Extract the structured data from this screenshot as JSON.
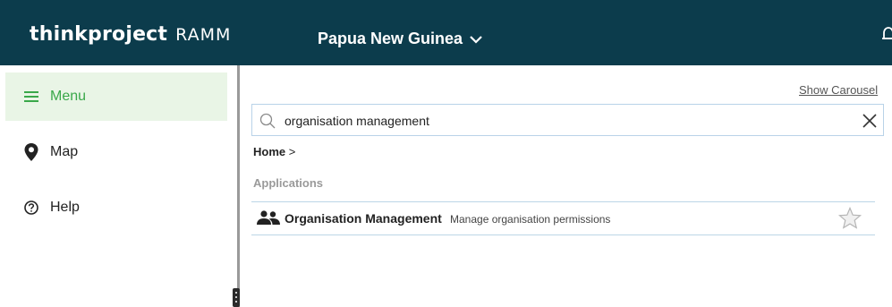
{
  "header": {
    "brand_name": "thinkproject",
    "brand_product": "RAMM",
    "region": "Papua New Guinea",
    "background": "#0c3c4c"
  },
  "sidebar": {
    "items": [
      {
        "label": "Menu",
        "icon": "hamburger-icon",
        "active": true
      },
      {
        "label": "Map",
        "icon": "map-pin-icon",
        "active": false
      },
      {
        "label": "Help",
        "icon": "help-circle-icon",
        "active": false
      }
    ],
    "active_color": "#3aa84a"
  },
  "main": {
    "show_carousel": "Show Carousel",
    "search": {
      "value": "organisation management"
    },
    "breadcrumb": {
      "home": "Home",
      "separator": ">"
    },
    "section": "Applications",
    "applications": [
      {
        "icon": "people-icon",
        "name": "Organisation Management",
        "description": "Manage organisation permissions",
        "favorite": false
      }
    ]
  }
}
